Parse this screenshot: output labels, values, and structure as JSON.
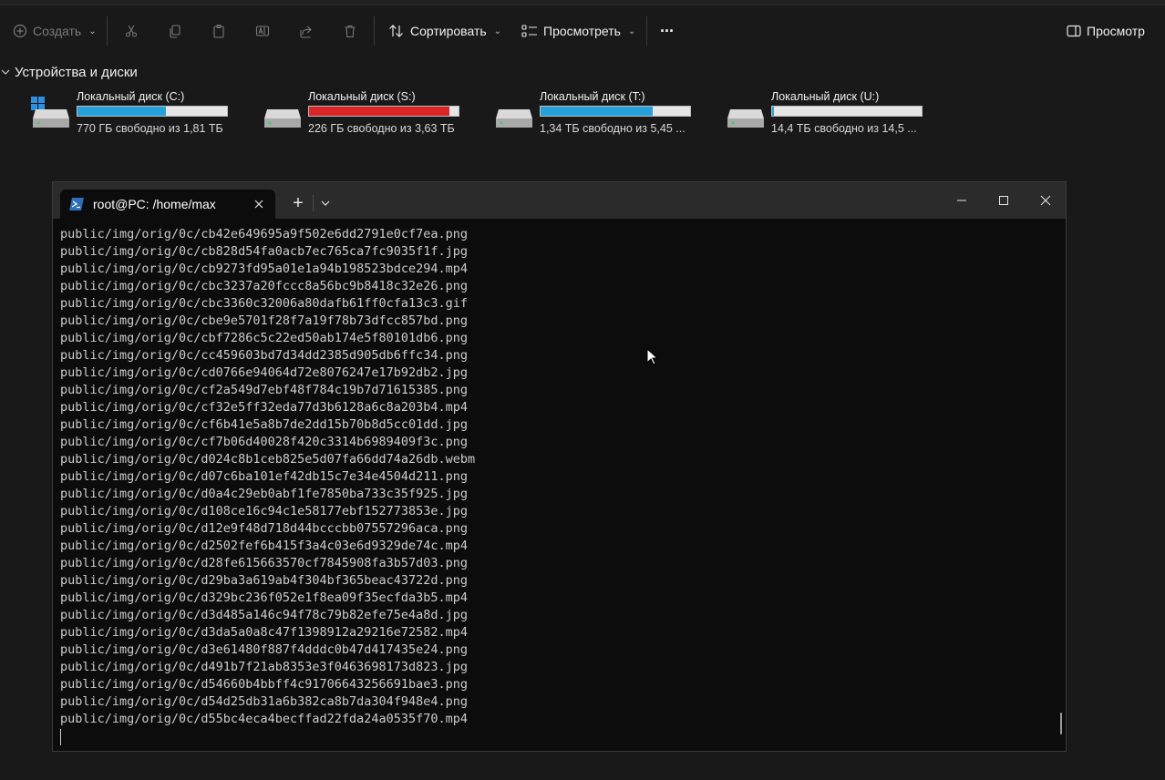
{
  "toolbar": {
    "create_label": "Создать",
    "sort_label": "Сортировать",
    "view_label": "Просмотреть",
    "more_label": "···",
    "preview_label": "Просмотр"
  },
  "devices": {
    "title": "Устройства и диски",
    "drives": [
      {
        "name": "Локальный диск (C:)",
        "free": "770 ГБ свободно из 1,81 ТБ",
        "used_fraction": 0.59,
        "color": "#26a0da",
        "windows": true
      },
      {
        "name": "Локальный диск (S:)",
        "free": "226 ГБ свободно из 3,63 ТБ",
        "used_fraction": 0.94,
        "color": "#da2626",
        "windows": false
      },
      {
        "name": "Локальный диск (T:)",
        "free": "1,34 ТБ свободно из 5,45 ...",
        "used_fraction": 0.75,
        "color": "#26a0da",
        "windows": false
      },
      {
        "name": "Локальный диск (U:)",
        "free": "14,4 ТБ свободно из 14,5 ...",
        "used_fraction": 0.01,
        "color": "#26a0da",
        "windows": false
      }
    ]
  },
  "terminal": {
    "tab_title": "root@PC: /home/max",
    "new_tab_label": "+",
    "lines": [
      "public/img/orig/0c/cb42e649695a9f502e6dd2791e0cf7ea.png",
      "public/img/orig/0c/cb828d54fa0acb7ec765ca7fc9035f1f.jpg",
      "public/img/orig/0c/cb9273fd95a01e1a94b198523bdce294.mp4",
      "public/img/orig/0c/cbc3237a20fccc8a56bc9b8418c32e26.png",
      "public/img/orig/0c/cbc3360c32006a80dafb61ff0cfa13c3.gif",
      "public/img/orig/0c/cbe9e5701f28f7a19f78b73dfcc857bd.png",
      "public/img/orig/0c/cbf7286c5c22ed50ab174e5f80101db6.png",
      "public/img/orig/0c/cc459603bd7d34dd2385d905db6ffc34.png",
      "public/img/orig/0c/cd0766e94064d72e8076247e17b92db2.jpg",
      "public/img/orig/0c/cf2a549d7ebf48f784c19b7d71615385.png",
      "public/img/orig/0c/cf32e5ff32eda77d3b6128a6c8a203b4.mp4",
      "public/img/orig/0c/cf6b41e5a8b7de2dd15b70b8d5cc01dd.jpg",
      "public/img/orig/0c/cf7b06d40028f420c3314b6989409f3c.png",
      "public/img/orig/0c/d024c8b1ceb825e5d07fa66dd74a26db.webm",
      "public/img/orig/0c/d07c6ba101ef42db15c7e34e4504d211.png",
      "public/img/orig/0c/d0a4c29eb0abf1fe7850ba733c35f925.jpg",
      "public/img/orig/0c/d108ce16c94c1e58177ebf152773853e.jpg",
      "public/img/orig/0c/d12e9f48d718d44bcccbb07557296aca.png",
      "public/img/orig/0c/d2502fef6b415f3a4c03e6d9329de74c.mp4",
      "public/img/orig/0c/d28fe615663570cf7845908fa3b57d03.png",
      "public/img/orig/0c/d29ba3a619ab4f304bf365beac43722d.png",
      "public/img/orig/0c/d329bc236f052e1f8ea09f35ecfda3b5.mp4",
      "public/img/orig/0c/d3d485a146c94f78c79b82efe75e4a8d.jpg",
      "public/img/orig/0c/d3da5a0a8c47f1398912a29216e72582.mp4",
      "public/img/orig/0c/d3e61480f887f4dddc0b47d417435e24.png",
      "public/img/orig/0c/d491b7f21ab8353e3f0463698173d823.jpg",
      "public/img/orig/0c/d54660b4bbff4c91706643256691bae3.png",
      "public/img/orig/0c/d54d25db31a6b382ca8b7da304f948e4.png",
      "public/img/orig/0c/d55bc4eca4becffad22fda24a0535f70.mp4"
    ]
  }
}
